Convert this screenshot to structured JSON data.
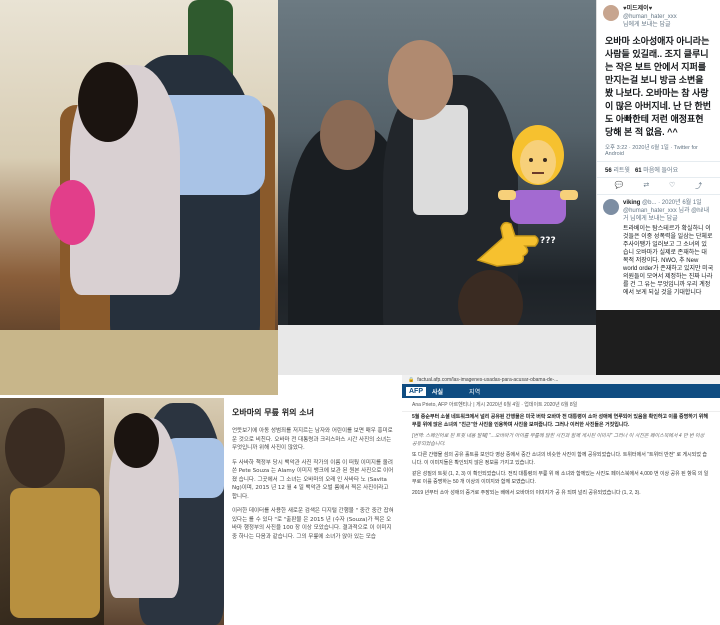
{
  "tweet": {
    "display_name": "♥미드제이♥",
    "handle": "@human_hater_xxx",
    "reply_note": "님에게 보내는 답글",
    "text": "오바마 소아성애자 아니라는 사람들 있길래.. 조지 클루니 는 작은 보트 안에서 지퍼를 만지는걸 보니 방금 소변을 봤 나보다. 오바마는 참 사랑이 많은 아버지네. 난 단 한번도 아빠한테 저런 애정표현 당해 본 적 없음. ^^",
    "meta": "오후 3:22 · 2020년 6월 1일 · Twitter for Android",
    "retweets_count": "56",
    "retweets_label": "리트윗",
    "likes_count": "61",
    "likes_label": "마음에 들어요",
    "actions": [
      "💬",
      "⇄",
      "♡",
      "⤴"
    ],
    "reply": {
      "display_name": "viking",
      "handle": "@b...",
      "date": "· 2020년 6월 1일",
      "note": "@human_hater_xxx 님과 @hi!내거 님에게 보내는 답글",
      "text": "트라베이는 탐스테르가 확실하니 이것들은 이중 성폭력을 일삼는 단체로 주사이쨍가 일러보고 그 소녀의 있 습니 오바마가 실제로 존재하는 대 목적 저장이다. NWO, 추 New world order가 존재하고 있지만 미국 의원들이 모여서 제정하는 진짜 나라를 건 그 유는 무엇입니까 우리 계정에서 보게 되실 것을 기대합니다"
    }
  },
  "emoji_label": "???",
  "kr_article": {
    "title": "오바마의 무릎 위의 소녀",
    "paragraphs": [
      "언뜻보기에 아동 성범죄를 저지르는 남자와 어린이를 보면 매우 흥미로운 것으로 비친다. 오바마 전 대통령과 크리스마스 시간 사진의 소녀는 무엇입니까 위해 사진이 많았다.",
      "두 사바하 책정부 당시 백악관 사진 작가의 이름 이 떠뒀 이미지를 올려 쓴 Pete Souza 는 Alamy 이미지 뱅크에 보관 된 원본 사진으로 이어졌 습니다. 그곳에서 그 소녀는 오바마의 오래 인 사바타 노 (Savita Ng)이며, 2015 년 12 월 4 일 백악관 오벌 룸에서 찍은 사진이라고 합니다.",
      "이러한 데이터를 사용한 새로운 검색은 디지털 간행물 \" 중간 중간 잡혀 있다는 를 수 있다 \"로 \"출판물 은 2015 년 (수자 (Souza)가 찍은 오바마 행정부의 사진을 100 장 이상 모았습니다. 결과적으로 이 이미지 중 하나는 다음과 같습니다. 그의 무릎에 소녀가 앉아 있는 모습"
    ]
  },
  "afp": {
    "url": "factual.afp.com/las-imagenes-usadas-para-acusar-obama-de-...",
    "logo": "AFP",
    "brand": "사실",
    "nav": "지역",
    "byline": "Ana Prieto, AFP 아르헨티나 | 게시 2020년 6월 4일 · 업데이트 2020년 6월 8일",
    "paragraphs": [
      "5월 중순부터 소셜 네트워크에서 널리 공유된 간행물은 미국 버락 오바마 전 대통령이 소아 성애에 연루되어 있음을 확인하고 이를 증명하기 위해 무릎 위에 앉은 소녀의 \"친근\"한 사진을 인용하며 사진을 보여줍니다. 그러나 이러한 사진들은 거짓입니다.",
      "[번역: 스페인어로 된 트윗 내용 발췌] \"...오바마가 아이를 무릎에 앉힌 사진과 함께 게시된 이미지\" 그러나 이 사진은 페이스북에서 4 만 번 이상 공유되었습니다.",
      "또 다른 간행물 섬의 공유 홀트를 보인다 영상 중에서 중간 소녀의 비슷한 사진이 함께 공유되었습니다. 트위터에서 \"트위터 반전\" 로 게시되었 습니다. 이 이미지들은 확인되지 않은 정보를 가지고 있습니다.",
      "같은 성질의 트윗 (1, 2, 3) 이 확인되었습니다. 전직 대통령의 무릎 위 에 소녀와 함께있는 사진도 페이스북에서 4,000 번 이상 공유 된 항목 의 일부로 이를 증명하는 50 개 이상의 이미지와 함께 모였습니다.",
      "2019 년부터 소아 성애의 증거로 주장되는 배에서 오바마의 이미지가 공 유 되며 널리 공유되었습니다 (1, 2, 3)."
    ]
  }
}
